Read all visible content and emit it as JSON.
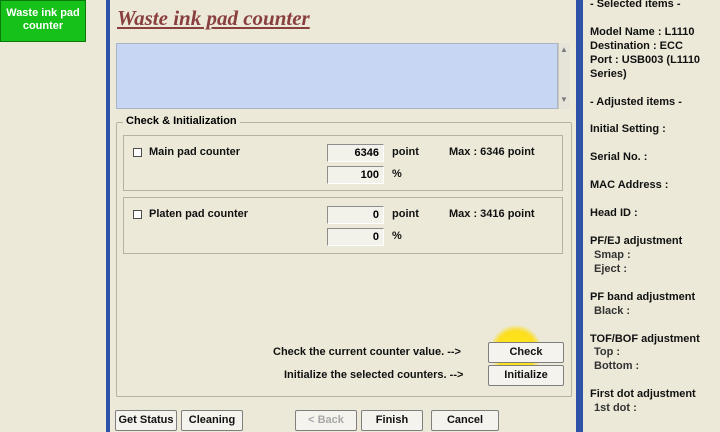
{
  "left": {
    "button_lines": [
      "Waste ink pad",
      "counter"
    ]
  },
  "main": {
    "title": "Waste ink pad counter",
    "group_label": "Check & Initialization",
    "main_pad": {
      "label": "Main pad counter",
      "value": "6346",
      "unit": "point",
      "max": "Max : 6346 point",
      "percent": "100",
      "percent_unit": "%"
    },
    "platen_pad": {
      "label": "Platen pad counter",
      "value": "0",
      "unit": "point",
      "max": "Max : 3416 point",
      "percent": "0",
      "percent_unit": "%"
    },
    "check_text": "Check the current counter value. -->",
    "check_button": "Check",
    "init_text": "Initialize the selected counters. -->",
    "init_button": "Initialize",
    "bottom": {
      "get_status": "Get Status",
      "cleaning": "Cleaning",
      "back": "< Back",
      "finish": "Finish",
      "cancel": "Cancel"
    }
  },
  "right": {
    "selected_header": "- Selected items -",
    "model_lines": [
      "Model Name : L1110",
      "Destination : ECC",
      "Port : USB003 (L1110",
      "Series)"
    ],
    "adjusted_header": "- Adjusted items -",
    "initial_setting": "Initial Setting :",
    "serial_no": "Serial No. :",
    "mac_address": "MAC Address :",
    "head_id": "Head ID :",
    "pfej": "PF/EJ adjustment",
    "smap": "Smap :",
    "eject": "Eject :",
    "pfband": "PF band adjustment",
    "black": "Black :",
    "tofbof": "TOF/BOF adjustment",
    "top": "Top :",
    "bottom": "Bottom :",
    "firstdot": "First dot adjustment",
    "firstdot_sub": "1st dot :"
  }
}
